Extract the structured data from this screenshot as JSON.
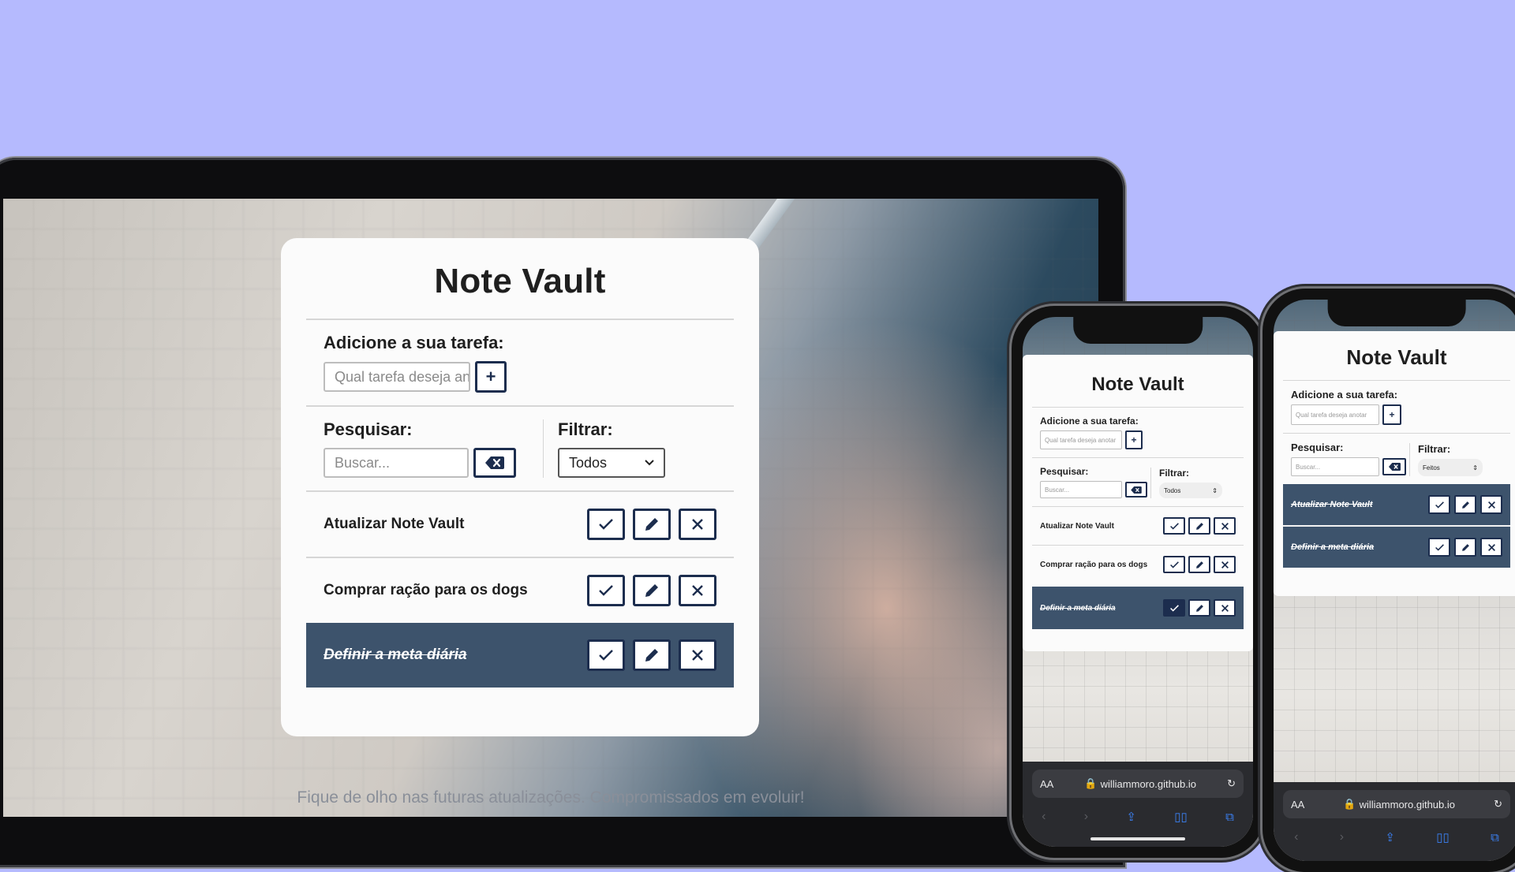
{
  "colors": {
    "background": "#b5bafe",
    "navy": "#1c2d4e",
    "done_row": "#3d536c",
    "card": "#fbfbfb"
  },
  "app": {
    "title": "Note Vault",
    "add_label": "Adicione a sua tarefa:",
    "add_placeholder": "Qual tarefa deseja anotar",
    "add_button": "+",
    "search_label": "Pesquisar:",
    "search_placeholder": "Buscar...",
    "clear_icon": "backspace-icon",
    "filter_label": "Filtrar:",
    "filter_value": "Todos",
    "todos": [
      {
        "text": "Atualizar Note Vault",
        "done": false
      },
      {
        "text": "Comprar ração para os dogs",
        "done": false
      },
      {
        "text": "Definir a meta diária",
        "done": true
      }
    ],
    "action_icons": [
      "check-icon",
      "pencil-icon",
      "close-icon"
    ],
    "footer": "Fique de olho nas futuras atualizações. Compromissados em evoluir!"
  },
  "phone1": {
    "title": "Note Vault",
    "add_label": "Adicione a sua tarefa:",
    "add_placeholder": "Qual tarefa deseja anotar",
    "search_label": "Pesquisar:",
    "search_placeholder": "Buscar...",
    "filter_label": "Filtrar:",
    "filter_value": "Todos",
    "todos": [
      {
        "text": "Atualizar Note Vault",
        "done": false
      },
      {
        "text": "Comprar ração para os dogs",
        "done": false
      },
      {
        "text": "Definir a meta diária",
        "done": true
      }
    ],
    "url_aa": "AA",
    "url": "williammoro.github.io"
  },
  "phone2": {
    "title": "Note Vault",
    "add_label": "Adicione a sua tarefa:",
    "add_placeholder": "Qual tarefa deseja anotar",
    "search_label": "Pesquisar:",
    "search_placeholder": "Buscar...",
    "filter_label": "Filtrar:",
    "filter_value": "Feitos",
    "todos": [
      {
        "text": "Atualizar Note Vault",
        "done": true
      },
      {
        "text": "Definir a meta diária",
        "done": true
      }
    ],
    "url_aa": "AA",
    "url": "williammoro.github.io"
  }
}
